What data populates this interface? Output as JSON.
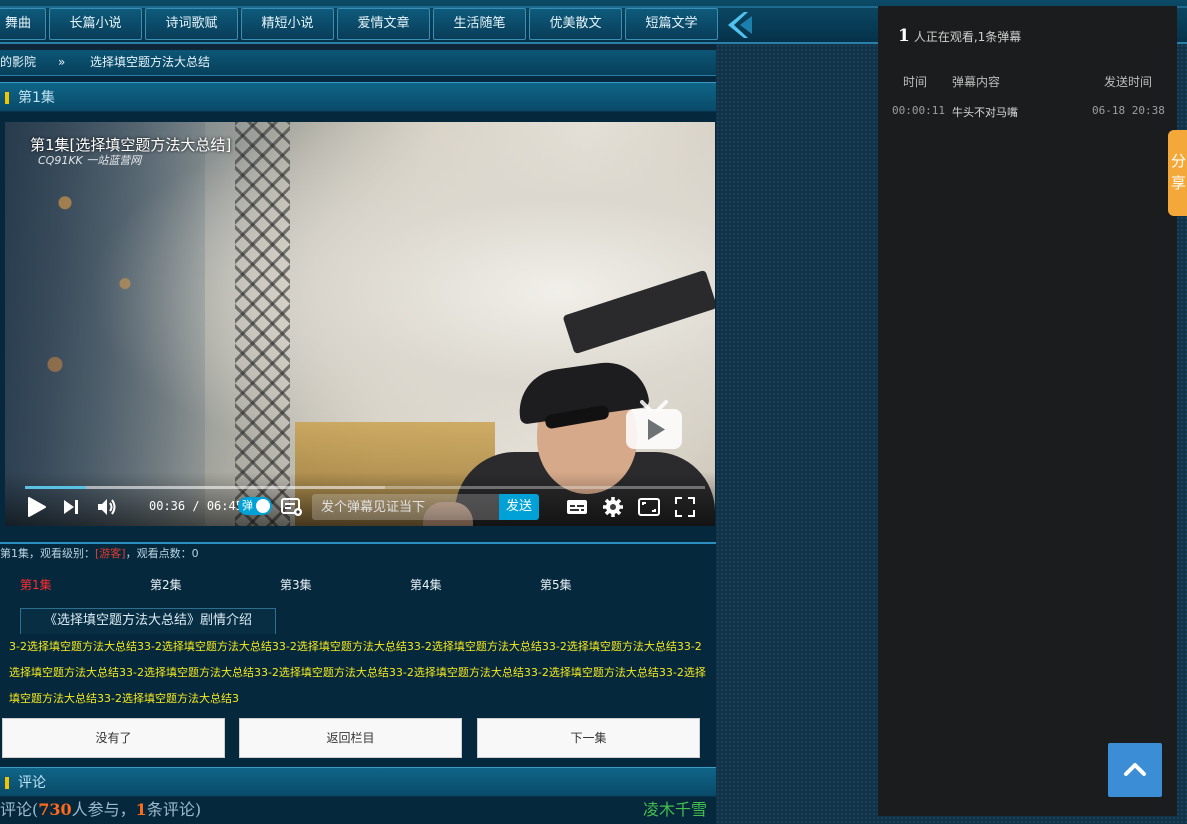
{
  "nav": {
    "items": [
      "舞曲",
      "长篇小说",
      "诗词歌赋",
      "精短小说",
      "爱情文章",
      "生活随笔",
      "优美散文",
      "短篇文学"
    ]
  },
  "breadcrumb": {
    "parent": "的影院",
    "separator": "»",
    "current": "选择填空题方法大总结"
  },
  "episode_section": {
    "title": "第1集"
  },
  "player": {
    "title_overlay": "第1集[选择填空题方法大总结]",
    "watermark": "CQ91KK 一站蓝营网",
    "current_time": "00:36",
    "duration": "06:45",
    "progress_fraction": 0.089,
    "danmaku_toggle_label": "弹",
    "danmaku_placeholder": "发个弹幕见证当下",
    "send_label": "发送",
    "accent_color": "#00a1d6"
  },
  "meta": {
    "prefix": "第1集，观看级别：",
    "level": "[游客]",
    "suffix": "，观看点数：0"
  },
  "episodes": [
    "第1集",
    "第2集",
    "第3集",
    "第4集",
    "第5集"
  ],
  "intro": {
    "tab_label": "《选择填空题方法大总结》剧情介绍",
    "text": "3-2选择填空题方法大总结33-2选择填空题方法大总结33-2选择填空题方法大总结33-2选择填空题方法大总结33-2选择填空题方法大总结33-2选择填空题方法大总结33-2选择填空题方法大总结33-2选择填空题方法大总结33-2选择填空题方法大总结33-2选择填空题方法大总结33-2选择填空题方法大总结33-2选择填空题方法大总结3"
  },
  "buttons": {
    "prev": "没有了",
    "back": "返回栏目",
    "next": "下一集"
  },
  "comments": {
    "section_title": "评论",
    "summary_prefix": "评论(",
    "participants": "730",
    "participants_suffix": "人参与，",
    "count": "1",
    "count_suffix": "条评论)",
    "user": "凌木千雪"
  },
  "danmaku_panel": {
    "viewers": "1",
    "viewers_text": "人正在观看,1条弹幕",
    "headers": {
      "time": "时间",
      "content": "弹幕内容",
      "sent": "发送时间"
    },
    "rows": [
      {
        "time": "00:00:11",
        "content": "牛头不对马嘴",
        "sent": "06-18 20:38"
      }
    ]
  },
  "share_tab": {
    "label": "分享"
  },
  "icons": {
    "play": "play-icon",
    "next": "skip-next-icon",
    "volume": "volume-icon",
    "settings": "gear-icon",
    "subtitle": "subtitle-icon",
    "widescreen": "widescreen-icon",
    "fullscreen": "fullscreen-icon",
    "tv": "tv-play-icon",
    "scroll_top": "chevron-up-icon",
    "nav_arrow": "chevron-left-icon"
  }
}
